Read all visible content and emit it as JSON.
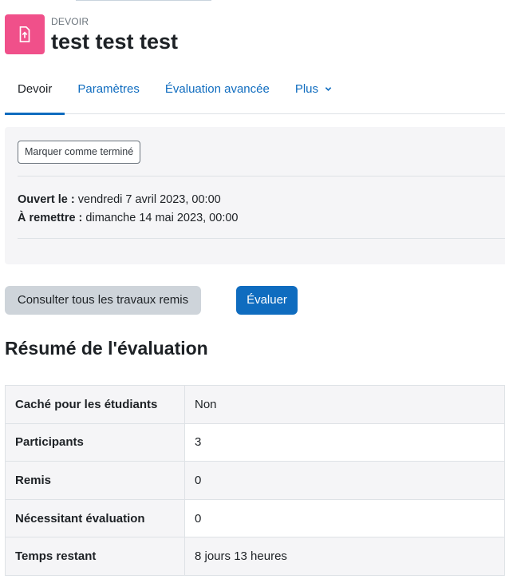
{
  "header": {
    "kicker": "DEVOIR",
    "title": "test test test",
    "icon": "assignment-upload-icon",
    "icon_color": "#f0508a"
  },
  "tabs": [
    {
      "label": "Devoir",
      "active": true
    },
    {
      "label": "Paramètres",
      "active": false
    },
    {
      "label": "Évaluation avancée",
      "active": false
    },
    {
      "label": "Plus",
      "active": false,
      "icon": "chevron-down-icon"
    }
  ],
  "activity": {
    "mark_done_label": "Marquer comme terminé",
    "opened_label": "Ouvert le :",
    "opened_value": "vendredi 7 avril 2023, 00:00",
    "due_label": "À remettre :",
    "due_value": "dimanche 14 mai 2023, 00:00"
  },
  "actions": {
    "view_all_label": "Consulter tous les travaux remis",
    "grade_label": "Évaluer"
  },
  "summary": {
    "title": "Résumé de l'évaluation",
    "rows": [
      {
        "key": "Caché pour les étudiants",
        "value": "Non"
      },
      {
        "key": "Participants",
        "value": "3"
      },
      {
        "key": "Remis",
        "value": "0"
      },
      {
        "key": "Nécessitant évaluation",
        "value": "0"
      },
      {
        "key": "Temps restant",
        "value": "8 jours 13 heures"
      }
    ]
  },
  "colors": {
    "accent": "#0f6cbf",
    "secondary_button": "#ced4da",
    "panel_background": "#f5f5f7"
  }
}
